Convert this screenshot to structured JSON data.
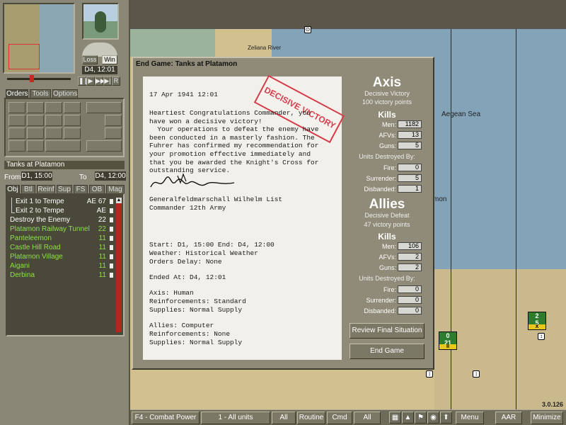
{
  "window": {
    "title": "End Game: Tanks at Platamon",
    "version": "3.0.126"
  },
  "left_panel": {
    "date_turn": "D4, 12:01",
    "loss_label": "Loss",
    "win_label": "Win",
    "tabs": [
      "Orders",
      "Tools",
      "Options"
    ],
    "scenario_name": "Tanks at Platamon",
    "from_label": "From",
    "from_value": "D1, 15:00",
    "to_label": "To",
    "to_value": "D4, 12:00",
    "obj_tabs": [
      "Obj",
      "Btl",
      "Reinf",
      "Sup",
      "FS",
      "OB",
      "Mag"
    ],
    "objectives": [
      {
        "name": "Exit 1 to Tempe",
        "owner": "AE",
        "points": "67",
        "color": "#ffffff",
        "indent": true
      },
      {
        "name": "Exit 2 to Tempe",
        "owner": "AE",
        "points": "",
        "color": "#ffffff",
        "indent": true
      },
      {
        "name": "Destroy the Enemy",
        "owner": "",
        "points": "22",
        "color": "#ffffff",
        "indent": false
      },
      {
        "name": "Platamon Railway Tunnel",
        "owner": "",
        "points": "22",
        "color": "#8ae04a",
        "indent": false
      },
      {
        "name": "Panteleemon",
        "owner": "",
        "points": "11",
        "color": "#8ae04a",
        "indent": false
      },
      {
        "name": "Castle Hill Road",
        "owner": "",
        "points": "11",
        "color": "#8ae04a",
        "indent": false
      },
      {
        "name": "Platamon Village",
        "owner": "",
        "points": "11",
        "color": "#8ae04a",
        "indent": false
      },
      {
        "name": "Aigani",
        "owner": "",
        "points": "11",
        "color": "#8ae04a",
        "indent": false
      },
      {
        "name": "Derbina",
        "owner": "",
        "points": "11",
        "color": "#8ae04a",
        "indent": false
      }
    ]
  },
  "map": {
    "labels": {
      "river": "Zeliana River",
      "sea": "Aegean Sea",
      "town": "mon"
    },
    "counters": [
      {
        "top": "0",
        "mid": "21",
        "bot": "II"
      },
      {
        "top": "2",
        "mid": "5",
        "bot": "X"
      }
    ]
  },
  "letter": {
    "stamp": "DECISIVE VICTORY",
    "date": "17 Apr 1941 12:01",
    "body": "Heartiest Congratulations Commander, you\nhave won a decisive victory!\n  Your operations to defeat the enemy have\nbeen conducted in a masterly fashion. The\nFuhrer has confirmed my recommendation for\nyour promotion effective immediately and\nthat you be awarded the Knight's Cross for\noutstanding service.",
    "signer": "Generalfeldmarschall Wilhelm List",
    "signer_title": "Commander 12th Army",
    "start_line": "Start: D1, 15:00 End: D4, 12:00",
    "weather": "Weather: Historical Weather",
    "orders_delay": "Orders Delay: None",
    "ended_at": "Ended At: D4, 12:01",
    "axis_player": "Axis: Human",
    "axis_reinf": "Reinforcements: Standard",
    "axis_supplies": "Supplies: Normal Supply",
    "allies_player": "Allies: Computer",
    "allies_reinf": "Reinforcements: None",
    "allies_supplies": "Supplies: Normal Supply"
  },
  "axis": {
    "name": "Axis",
    "result": "Decisive Victory",
    "points": "100 victory points",
    "kills_label": "Kills",
    "men_label": "Men:",
    "men": "1182",
    "afvs_label": "AFVs:",
    "afvs": "13",
    "guns_label": "Guns:",
    "guns": "5",
    "destroyed_label": "Units Destroyed By:",
    "fire_label": "Fire:",
    "fire": "0",
    "surrender_label": "Surrender:",
    "surrender": "5",
    "disbanded_label": "Disbanded:",
    "disbanded": "1"
  },
  "allies": {
    "name": "Allies",
    "result": "Decisive Defeat",
    "points": "47 victory points",
    "kills_label": "Kills",
    "men_label": "Men:",
    "men": "106",
    "afvs_label": "AFVs:",
    "afvs": "2",
    "guns_label": "Guns:",
    "guns": "2",
    "destroyed_label": "Units Destroyed By:",
    "fire_label": "Fire:",
    "fire": "0",
    "surrender_label": "Surrender:",
    "surrender": "0",
    "disbanded_label": "Disbanded:",
    "disbanded": "0"
  },
  "dialog_buttons": {
    "review": "Review Final Situation",
    "end": "End Game"
  },
  "bottom_bar": {
    "combat_power": "F4 - Combat Power",
    "all_units": "1 - All units",
    "all1": "All",
    "routine": "Routine",
    "cmd": "Cmd",
    "all2": "All",
    "menu": "Menu",
    "aar": "AAR",
    "minimize": "Minimize"
  },
  "colors": {
    "objective_green": "#8ae04a",
    "stamp_red": "#d53c4a",
    "sea": "#83a4b8",
    "land": "#d9c99c"
  }
}
